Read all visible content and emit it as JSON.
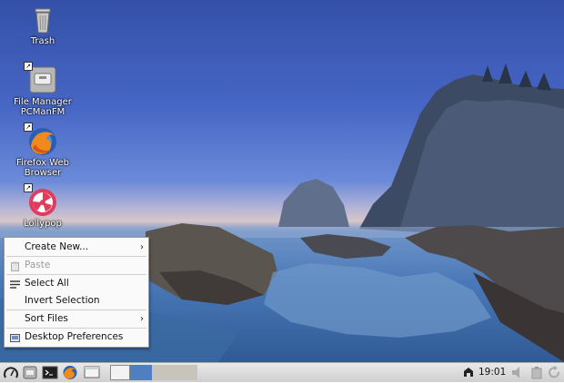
{
  "desktop_icons": [
    {
      "name": "trash",
      "label_lines": [
        "Trash"
      ],
      "icon": "trash-icon",
      "shortcut": false
    },
    {
      "name": "file-manager",
      "label_lines": [
        "File Manager",
        "PCManFM"
      ],
      "icon": "file-manager-icon",
      "shortcut": true
    },
    {
      "name": "firefox",
      "label_lines": [
        "Firefox Web",
        "Browser"
      ],
      "icon": "firefox-icon",
      "shortcut": true
    },
    {
      "name": "lollypop",
      "label_lines": [
        "Lollypop"
      ],
      "icon": "lollypop-icon",
      "shortcut": true
    }
  ],
  "context_menu": {
    "create_new": "Create New...",
    "paste": "Paste",
    "select_all": "Select All",
    "invert_selection": "Invert Selection",
    "sort_files": "Sort Files",
    "desktop_preferences": "Desktop Preferences",
    "submenu_arrow": "›"
  },
  "taskbar": {
    "clock": "19:01",
    "launchers": [
      "menu-icon",
      "file-manager-icon",
      "terminal-icon",
      "firefox-icon",
      "desktop-icon"
    ],
    "workspaces": 4,
    "active_workspace": 2
  },
  "colors": {
    "menu_bg": "#fafafa",
    "taskbar_bg": "#dcdcdc",
    "workspace_active": "#4f7fc0",
    "workspace_inactive": "#c8c4bc"
  }
}
